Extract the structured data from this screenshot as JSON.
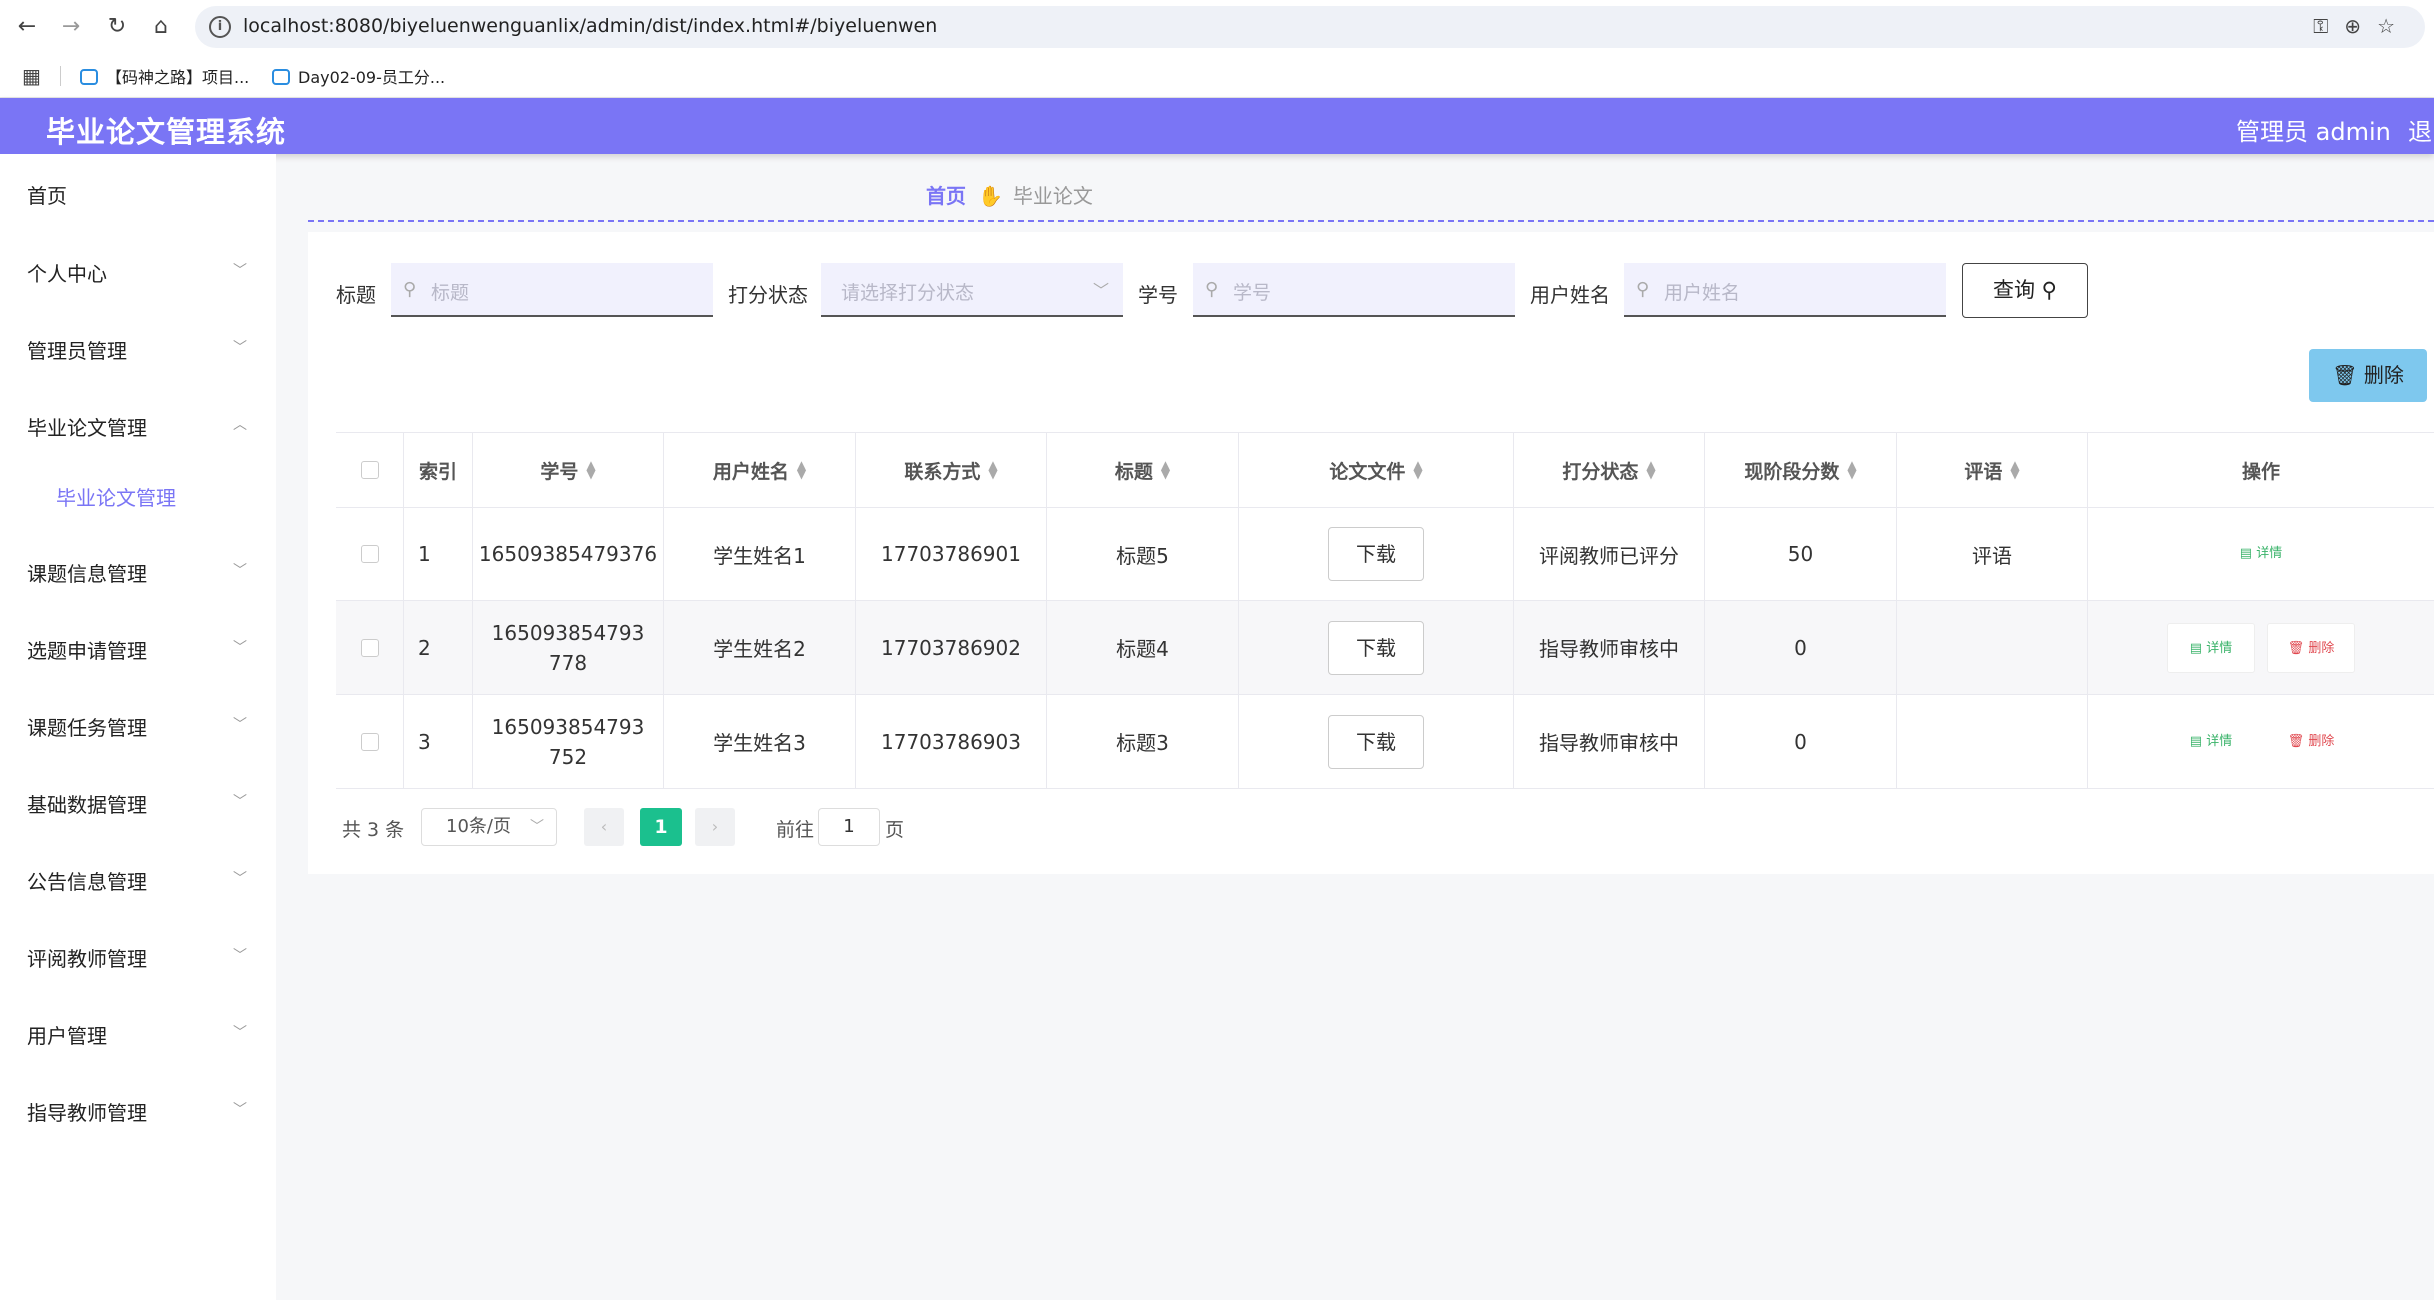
{
  "browser": {
    "url": "localhost:8080/biyeluenwenguanlix/admin/dist/index.html#/biyeluenwen",
    "bookmarks": [
      "【码神之路】项目...",
      "Day02-09-员工分..."
    ]
  },
  "header": {
    "title": "毕业论文管理系统",
    "admin": "管理员 admin",
    "logout": "退出"
  },
  "sidebar": {
    "items": [
      {
        "label": "首页"
      },
      {
        "label": "个人中心"
      },
      {
        "label": "管理员管理"
      },
      {
        "label": "毕业论文管理"
      },
      {
        "label": "毕业论文管理"
      },
      {
        "label": "课题信息管理"
      },
      {
        "label": "选题申请管理"
      },
      {
        "label": "课题任务管理"
      },
      {
        "label": "基础数据管理"
      },
      {
        "label": "公告信息管理"
      },
      {
        "label": "评阅教师管理"
      },
      {
        "label": "用户管理"
      },
      {
        "label": "指导教师管理"
      }
    ]
  },
  "breadcrumb": {
    "home": "首页",
    "current": "毕业论文"
  },
  "filters": {
    "title_label": "标题",
    "title_placeholder": "标题",
    "status_label": "打分状态",
    "status_placeholder": "请选择打分状态",
    "student_no_label": "学号",
    "student_no_placeholder": "学号",
    "username_label": "用户姓名",
    "username_placeholder": "用户姓名",
    "query_button": "查询",
    "delete_button": "删除"
  },
  "table": {
    "headers": [
      "索引",
      "学号",
      "用户姓名",
      "联系方式",
      "标题",
      "论文文件",
      "打分状态",
      "现阶段分数",
      "评语",
      "操作"
    ],
    "download_label": "下载",
    "detail_label": "详情",
    "delete_label": "删除",
    "rows": [
      {
        "index": "1",
        "student_no": "16509385479376",
        "username": "学生姓名1",
        "contact": "17703786901",
        "title": "标题5",
        "status": "评阅教师已评分",
        "score": "50",
        "comment": "评语"
      },
      {
        "index": "2",
        "student_no": "165093854793778",
        "username": "学生姓名2",
        "contact": "17703786902",
        "title": "标题4",
        "status": "指导教师审核中",
        "score": "0",
        "comment": ""
      },
      {
        "index": "3",
        "student_no": "165093854793752",
        "username": "学生姓名3",
        "contact": "17703786903",
        "title": "标题3",
        "status": "指导教师审核中",
        "score": "0",
        "comment": ""
      }
    ]
  },
  "pagination": {
    "total": "共 3 条",
    "page_size": "10条/页",
    "current_page": "1",
    "goto_label": "前往",
    "goto_value": "1",
    "page_suffix": "页"
  },
  "colors": {
    "accent": "#7a75f5",
    "success": "#1bc08e",
    "danger": "#e0484f",
    "delete_button": "#7ec8ee"
  },
  "icons": [
    "back-icon",
    "forward-icon",
    "reload-icon",
    "home-icon",
    "info-icon",
    "key-icon",
    "zoom-icon",
    "star-icon",
    "apps-icon",
    "search-icon",
    "chevron-down-icon",
    "hand-icon",
    "trash-icon",
    "detail-icon"
  ]
}
